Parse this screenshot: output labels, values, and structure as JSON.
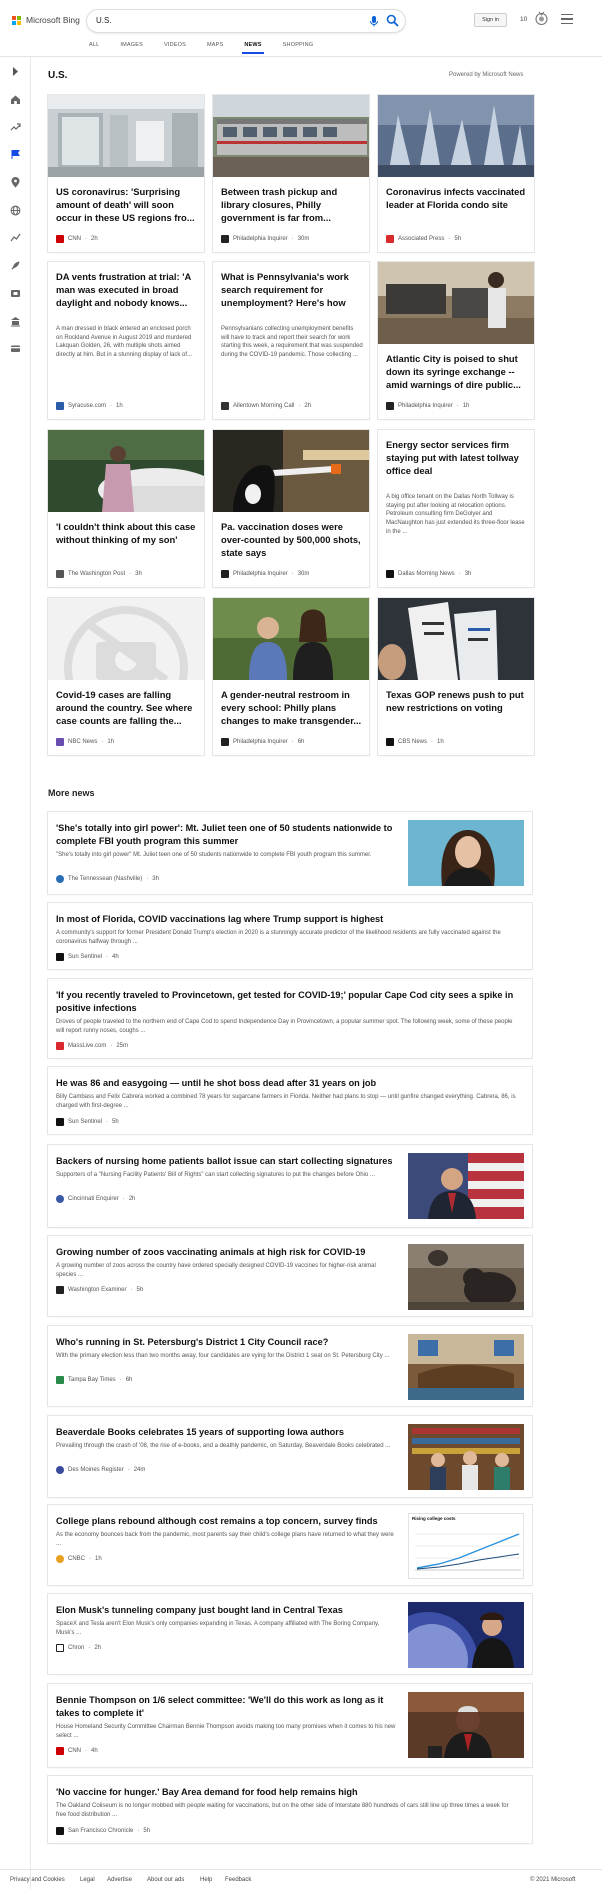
{
  "header": {
    "brand": "Microsoft Bing",
    "search_value": "U.S.",
    "signin_label": "Sign in",
    "points": "10",
    "tabs": [
      {
        "label": "ALL",
        "active": false
      },
      {
        "label": "IMAGES",
        "active": false
      },
      {
        "label": "VIDEOS",
        "active": false
      },
      {
        "label": "MAPS",
        "active": false
      },
      {
        "label": "NEWS",
        "active": true
      },
      {
        "label": "SHOPPING",
        "active": false
      }
    ]
  },
  "sidebar": {
    "icons": [
      "expand-arrow-icon",
      "home-icon",
      "trending-icon",
      "flag-icon",
      "location-pin-icon",
      "globe-icon",
      "chart-icon",
      "rocket-icon",
      "film-icon",
      "building-icon",
      "card-icon"
    ]
  },
  "section": {
    "title": "U.S.",
    "powered_by": "Powered by Microsoft News"
  },
  "cards": [
    {
      "headline": "US coronavirus: 'Surprising amount of death' will soon occur in these US regions fro...",
      "source": "CNN",
      "time": "2h",
      "desc": ""
    },
    {
      "headline": "Between trash pickup and library closures, Philly government is far from...",
      "source": "Philadelphia Inquirer",
      "time": "30m",
      "desc": ""
    },
    {
      "headline": "Coronavirus infects vaccinated leader at Florida condo site",
      "source": "Associated Press",
      "time": "5h",
      "desc": ""
    },
    {
      "headline": "DA vents frustration at trial: 'A man was executed in broad daylight and nobody knows...",
      "source": "Syracuse.com",
      "time": "1h",
      "desc": "A man dressed in black entered an enclosed porch on Rockland Avenue in August 2019 and murdered Lakquan Golden, 26, with multiple shots aimed directly at him. But in a stunning display of lack of..."
    },
    {
      "headline": "What is Pennsylvania's work search requirement for unemployment? Here's how to...",
      "source": "Allentown Morning Call",
      "time": "2h",
      "desc": "Pennsylvanians collecting unemployment benefits will have to track and report their search for work starting this week, a requirement that was suspended during the COVID-19 pandemic. Those collecting ..."
    },
    {
      "headline": "Atlantic City is poised to shut down its syringe exchange -- amid warnings of dire public...",
      "source": "Philadelphia Inquirer",
      "time": "1h",
      "desc": ""
    },
    {
      "headline": "'I couldn't think about this case without thinking of my son'",
      "source": "The Washington Post",
      "time": "3h",
      "desc": ""
    },
    {
      "headline": "Pa. vaccination doses were over-counted by 500,000 shots, state says",
      "source": "Philadelphia Inquirer",
      "time": "30m",
      "desc": ""
    },
    {
      "headline": "Energy sector services firm staying put with latest tollway office deal",
      "source": "Dallas Morning News",
      "time": "3h",
      "desc": "A big office tenant on the Dallas North Tollway is staying put after looking at relocation options. Petroleum consulting firm DeGolyer and MacNaughton has just extended its three-floor lease in the ..."
    },
    {
      "headline": "Covid-19 cases are falling around the country. See where case counts are falling the...",
      "source": "NBC News",
      "time": "1h",
      "desc": ""
    },
    {
      "headline": "A gender-neutral restroom in every school: Philly plans changes to make transgender...",
      "source": "Philadelphia Inquirer",
      "time": "6h",
      "desc": ""
    },
    {
      "headline": "Texas GOP renews push to put new restrictions on voting",
      "source": "CBS News",
      "time": "1h",
      "desc": ""
    }
  ],
  "more_news": {
    "title": "More news",
    "items": [
      {
        "headline": "'She's totally into girl power': Mt. Juliet teen one of 50 students nationwide to complete FBI youth program this summer",
        "desc": "\"She's totally into girl power\" Mt. Juliet teen one of 50 students nationwide to complete FBI youth program this summer.",
        "source": "The Tennessean (Nashville)",
        "time": "3h"
      },
      {
        "headline": "In most of Florida, COVID vaccinations lag where Trump support is highest",
        "desc": "A community's support for former President Donald Trump's election in 2020 is a stunningly accurate predictor of the likelihood residents are fully vaccinated against the coronavirus halfway through ...",
        "source": "Sun Sentinel",
        "time": "4h"
      },
      {
        "headline": "'If you recently traveled to Provincetown, get tested for COVID-19;' popular Cape Cod city sees a spike in positive infections",
        "desc": "Droves of people traveled to the northern end of Cape Cod to spend Independence Day in Provincetown, a popular summer spot. The following week, some of these people will report runny noses, coughs ...",
        "source": "MassLive.com",
        "time": "25m"
      },
      {
        "headline": "He was 86 and easygoing — until he shot boss dead after 31 years on job",
        "desc": "Billy Cambass and Felix Cabrera worked a combined 78 years for sugarcane farmers in Florida. Neither had plans to stop — until gunfire changed everything. Cabrera, 86, is charged with first-degree ...",
        "source": "Sun Sentinel",
        "time": "5h"
      },
      {
        "headline": "Backers of nursing home patients ballot issue can start collecting signatures",
        "desc": "Supporters of a \"Nursing Facility Patients' Bill of Rights\" can start collecting signatures to put the changes before Ohio ...",
        "source": "Cincinnati Enquirer",
        "time": "2h"
      },
      {
        "headline": "Growing number of zoos vaccinating animals at high risk for COVID-19",
        "desc": "A growing number of zoos across the country have ordered specially designed COVID-19 vaccines for higher-risk animal species ...",
        "source": "Washington Examiner",
        "time": "5h"
      },
      {
        "headline": "Who's running in St. Petersburg's District 1 City Council race?",
        "desc": "With the primary election less than two months away, four candidates are vying for the District 1 seat on St. Petersburg City ...",
        "source": "Tampa Bay Times",
        "time": "6h"
      },
      {
        "headline": "Beaverdale Books celebrates 15 years of supporting Iowa authors",
        "desc": "Prevailing through the crash of '08, the rise of e-books, and a deathly pandemic, on Saturday, Beaverdale Books celebrated ...",
        "source": "Des Moines Register",
        "time": "24m"
      },
      {
        "headline": "College plans rebound although cost remains a top concern, survey finds",
        "desc": "As the economy bounces back from the pandemic, most parents say their child's college plans have returned to what they were ...",
        "source": "CNBC",
        "time": "1h",
        "thumb_title": "Rising college costs"
      },
      {
        "headline": "Elon Musk's tunneling company just bought land in Central Texas",
        "desc": "SpaceX and Tesla aren't Elon Musk's only companies expanding in Texas. A company affiliated with The Boring Company, Musk's ...",
        "source": "Chron",
        "time": "2h"
      },
      {
        "headline": "Bennie Thompson on 1/6 select committee: 'We'll do this work as long as it takes to complete it'",
        "desc": "House Homeland Security Committee Chairman Bennie Thompson avoids making too many promises when it comes to his new select ...",
        "source": "CNN",
        "time": "4h"
      },
      {
        "headline": "'No vaccine for hunger.' Bay Area demand for food help remains high",
        "desc": "The Oakland Coliseum is no longer mobbed with people waiting for vaccinations, but on the other side of Interstate 880 hundreds of cars still line up three times a week for free food distribution ...",
        "source": "San Francisco Chronicle",
        "time": "5h"
      }
    ]
  },
  "footer": {
    "links": [
      "Privacy and Cookies",
      "Legal",
      "Advertise",
      "About our ads",
      "Help",
      "Feedback"
    ],
    "copyright": "© 2021 Microsoft"
  },
  "colors": {
    "accent": "#174ae4",
    "search_icon": "#0c63d4"
  }
}
